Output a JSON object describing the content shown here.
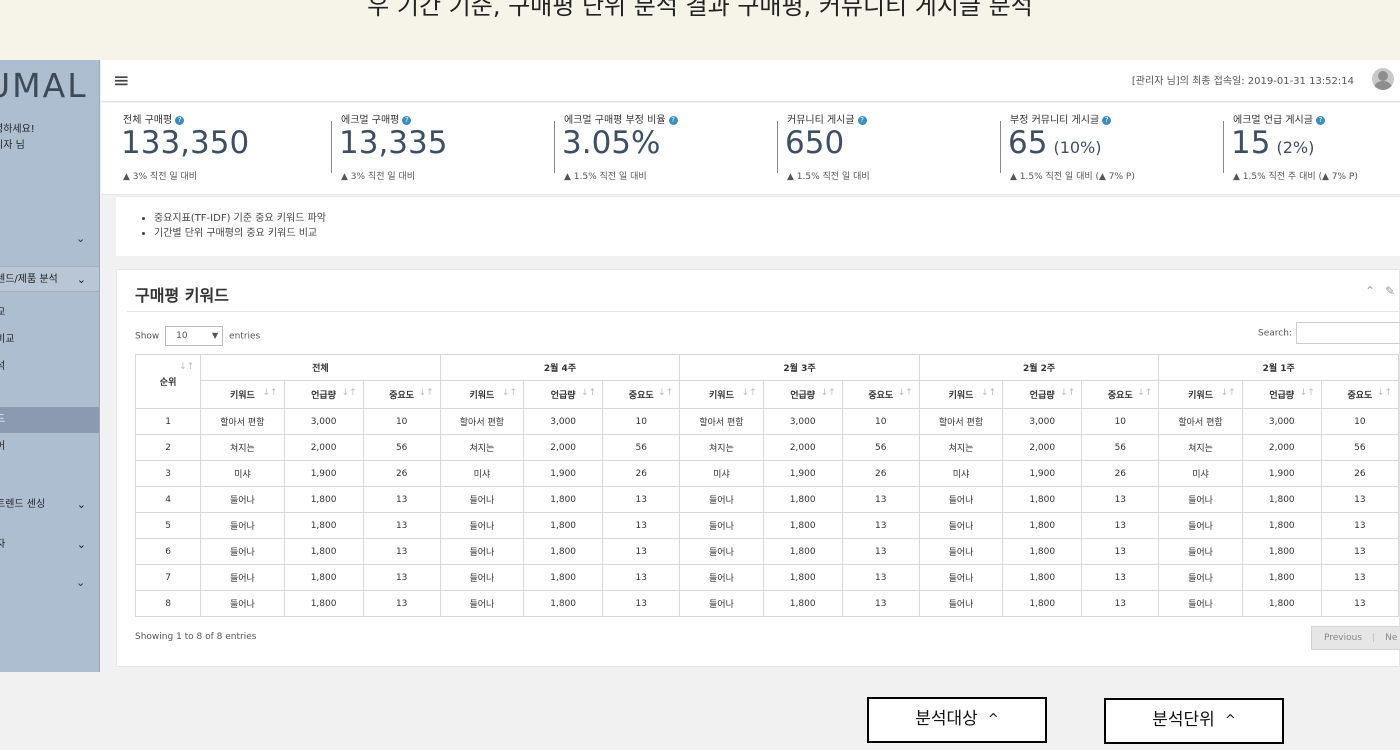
{
  "caption": "우 기간 기준, 구매평 단위 분석 결과 구매평, 커뮤니티 게시글 분석",
  "brand": "UMAL",
  "sidebar": {
    "greeting_line1": "녕하세요!",
    "greeting_line2": "리자 님",
    "section1": "렌드/제품 분석",
    "item1": "교",
    "item2": "비교",
    "item3": "석",
    "item4_active": "드",
    "item5": "어",
    "section2": "트렌드 센싱",
    "section3": "자"
  },
  "topbar": {
    "last_login": "[관리자 님]의 최종 접속일: 2019-01-31 13:52:14"
  },
  "stats": [
    {
      "label": "전체 구매평",
      "value": "133,350",
      "pct": "",
      "delta": "▲ 3% 직전 일 대비"
    },
    {
      "label": "에크멀 구매평",
      "value": "13,335",
      "pct": "",
      "delta": "▲ 3% 직전 일 대비"
    },
    {
      "label": "에크멀 구매평 부정 비율",
      "value": "3.05%",
      "pct": "",
      "delta": "▲ 1.5% 직전 일 대비"
    },
    {
      "label": "커뮤니티 게시글",
      "value": "650",
      "pct": "",
      "delta": "▲ 1.5% 직전 일 대비"
    },
    {
      "label": "부정 커뮤니티 게시글",
      "value": "65",
      "pct": "(10%)",
      "delta": "▲ 1.5% 직전 일 대비 (▲ 7% P)"
    },
    {
      "label": "에크멀 언급 게시글",
      "value": "15",
      "pct": "(2%)",
      "delta": "▲ 1.5% 직전 주 대비 (▲ 7% P)"
    }
  ],
  "bullets": [
    "중요지표(TF-IDF) 기준 중요 키워드 파악",
    "기간별 단위 구매평의 중요 키워드 비교"
  ],
  "panel": {
    "title": "구매평 키워드",
    "show_label": "Show",
    "entries_value": "10",
    "entries_label": "entries",
    "search_label": "Search:",
    "showing_text": "Showing 1 to 8 of 8 entries",
    "prev_label": "Previous",
    "next_label": "Ne"
  },
  "table": {
    "rank_header": "순위",
    "groups": [
      "전체",
      "2월 4주",
      "2월 3주",
      "2월 2주",
      "2월 1주"
    ],
    "sub_headers": [
      "키워드",
      "언급량",
      "중요도"
    ],
    "rows": [
      {
        "rank": "1",
        "keyword": "할아서 편함",
        "mentions": "3,000",
        "importance": "10"
      },
      {
        "rank": "2",
        "keyword": "쳐지는",
        "mentions": "2,000",
        "importance": "56"
      },
      {
        "rank": "3",
        "keyword": "미샤",
        "mentions": "1,900",
        "importance": "26"
      },
      {
        "rank": "4",
        "keyword": "들어나",
        "mentions": "1,800",
        "importance": "13"
      },
      {
        "rank": "5",
        "keyword": "들어나",
        "mentions": "1,800",
        "importance": "13"
      },
      {
        "rank": "6",
        "keyword": "들어나",
        "mentions": "1,800",
        "importance": "13"
      },
      {
        "rank": "7",
        "keyword": "들어나",
        "mentions": "1,800",
        "importance": "13"
      },
      {
        "rank": "8",
        "keyword": "들어나",
        "mentions": "1,800",
        "importance": "13"
      }
    ]
  },
  "buttons": {
    "target_label": "분석대상",
    "unit_label": "분석단위",
    "caret": "^"
  }
}
